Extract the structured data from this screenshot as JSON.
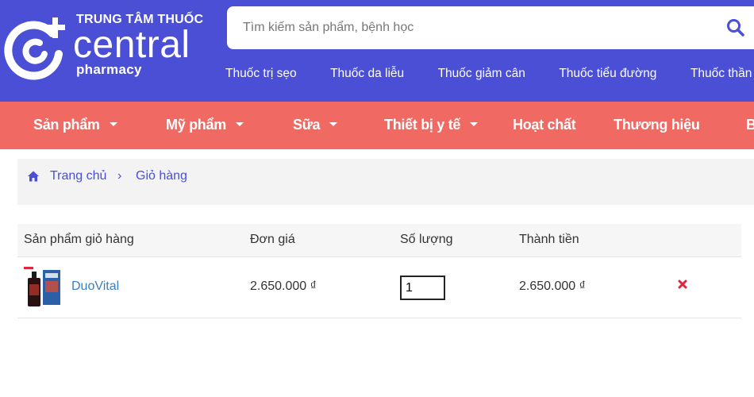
{
  "brand": {
    "top_text": "TRUNG TÂM THUỐC",
    "main_text": "central",
    "sub_text": "pharmacy"
  },
  "search": {
    "placeholder": "Tìm kiếm sản phẩm, bệnh học",
    "icon": "search-icon"
  },
  "quick_links": [
    "Thuốc trị sẹo",
    "Thuốc da liễu",
    "Thuốc giảm cân",
    "Thuốc tiểu đường",
    "Thuốc thần kinh"
  ],
  "main_nav": [
    {
      "label": "Sản phẩm",
      "has_dropdown": true
    },
    {
      "label": "Mỹ phẩm",
      "has_dropdown": true
    },
    {
      "label": "Sữa",
      "has_dropdown": true
    },
    {
      "label": "Thiết bị y tế",
      "has_dropdown": true
    },
    {
      "label": "Hoạt chất",
      "has_dropdown": false
    },
    {
      "label": "Thương hiệu",
      "has_dropdown": false
    },
    {
      "label": "Bệnh",
      "has_dropdown": false
    }
  ],
  "breadcrumb": {
    "home": "Trang chủ",
    "separator": "›",
    "current": "Giỏ hàng"
  },
  "cart": {
    "headers": [
      "Sản phẩm giỏ hàng",
      "Đơn giá",
      "Số lượng",
      "Thành tiền"
    ],
    "items": [
      {
        "name": "DuoVital",
        "unit_price": "2.650.000 ₫",
        "quantity": "1",
        "total": "2.650.000 ₫"
      }
    ]
  },
  "colors": {
    "header_bg": "#4a4fd6",
    "nav_bg": "#f06a63",
    "link": "#4a4fd6",
    "product_link": "#3a7fbd",
    "remove": "#e0263a"
  }
}
